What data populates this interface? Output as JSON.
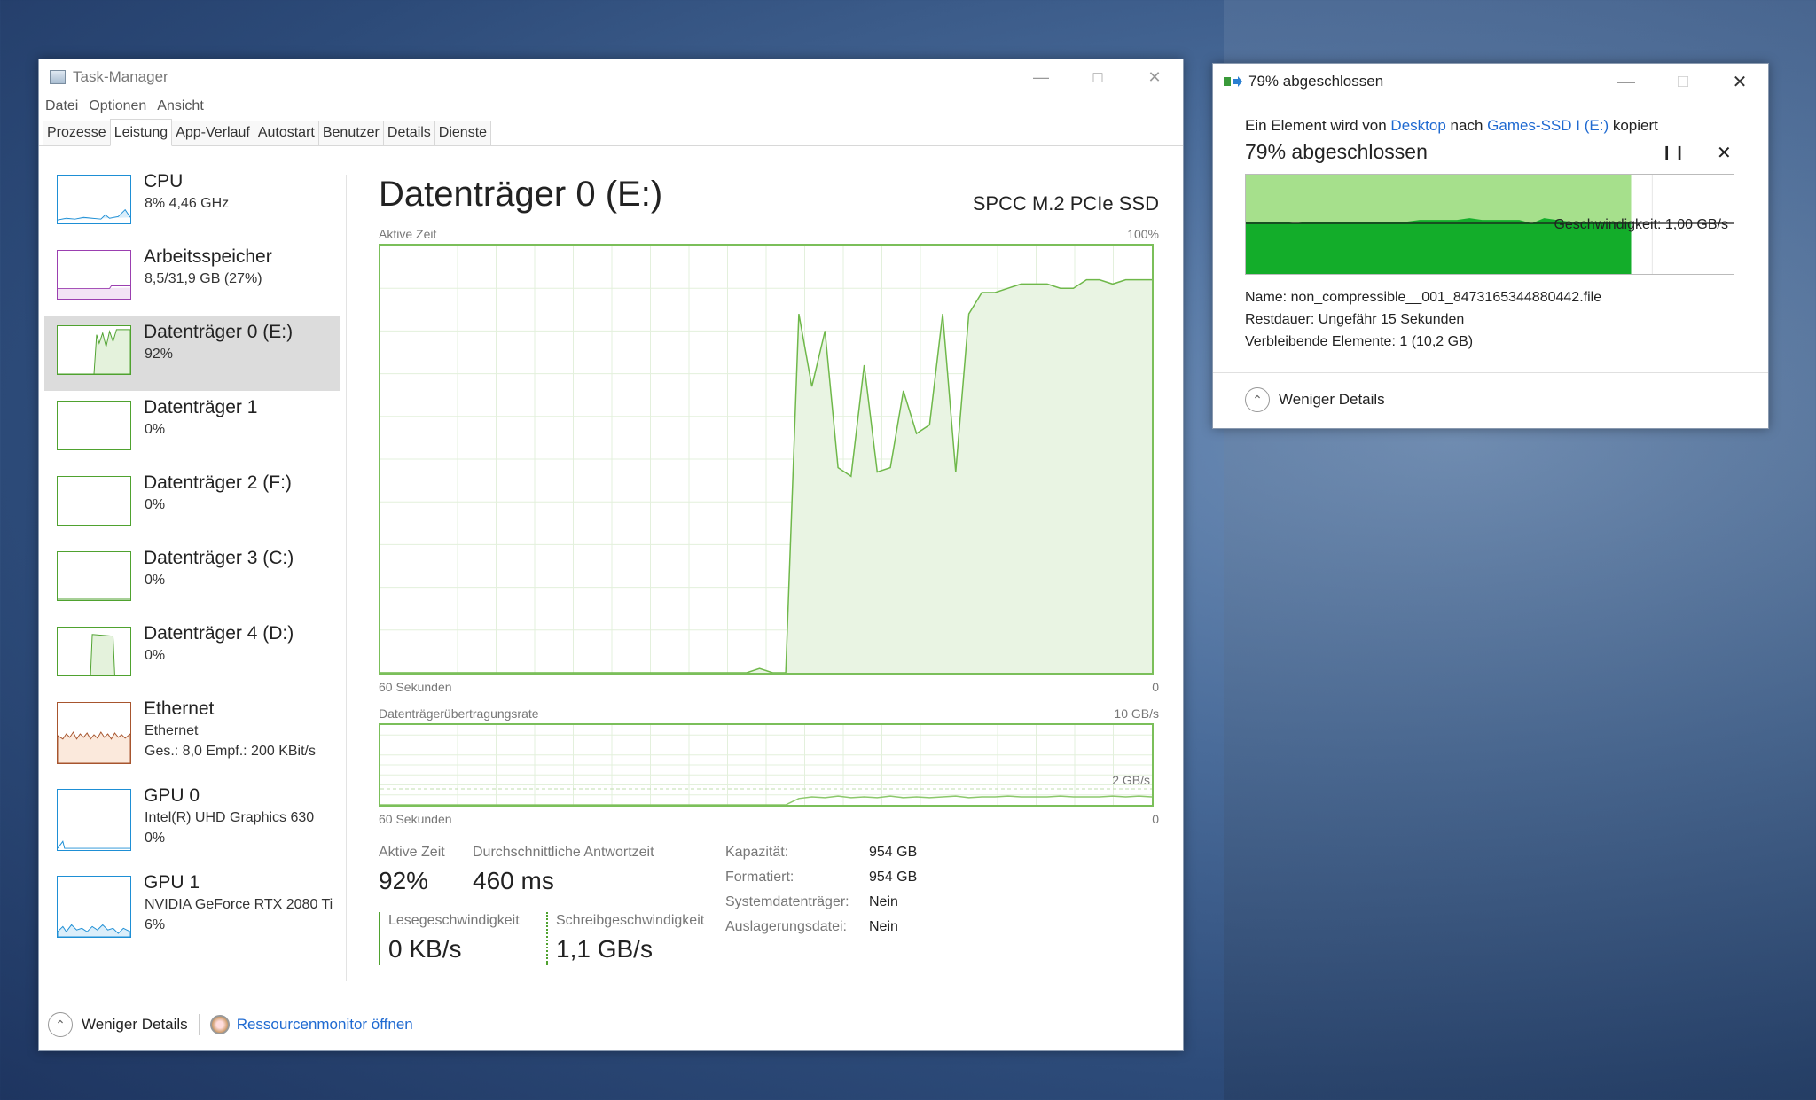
{
  "task_manager": {
    "title": "Task-Manager",
    "menu": [
      "Datei",
      "Optionen",
      "Ansicht"
    ],
    "tabs": [
      "Prozesse",
      "Leistung",
      "App-Verlauf",
      "Autostart",
      "Benutzer",
      "Details",
      "Dienste"
    ],
    "active_tab": "Leistung",
    "sidebar": [
      {
        "name": "CPU",
        "sub": "8%  4,46 GHz",
        "sub2": "",
        "color": "#1e8fd5",
        "selected": false
      },
      {
        "name": "Arbeitsspeicher",
        "sub": "8,5/31,9 GB (27%)",
        "sub2": "",
        "color": "#9b3fb0",
        "selected": false
      },
      {
        "name": "Datenträger 0 (E:)",
        "sub": "92%",
        "sub2": "",
        "color": "#4fa22f",
        "selected": true
      },
      {
        "name": "Datenträger 1",
        "sub": "0%",
        "sub2": "",
        "color": "#4fa22f",
        "selected": false
      },
      {
        "name": "Datenträger 2 (F:)",
        "sub": "0%",
        "sub2": "",
        "color": "#4fa22f",
        "selected": false
      },
      {
        "name": "Datenträger 3 (C:)",
        "sub": "0%",
        "sub2": "",
        "color": "#4fa22f",
        "selected": false
      },
      {
        "name": "Datenträger 4 (D:)",
        "sub": "0%",
        "sub2": "",
        "color": "#4fa22f",
        "selected": false
      },
      {
        "name": "Ethernet",
        "sub": "Ethernet",
        "sub2": "Ges.: 8,0  Empf.: 200 KBit/s",
        "color": "#a7552e",
        "selected": false
      },
      {
        "name": "GPU 0",
        "sub": "Intel(R) UHD Graphics 630",
        "sub2": "0%",
        "color": "#1e8fd5",
        "selected": false
      },
      {
        "name": "GPU 1",
        "sub": "NVIDIA GeForce RTX 2080 Ti",
        "sub2": "6%",
        "color": "#1e8fd5",
        "selected": false
      }
    ],
    "main": {
      "title": "Datenträger 0 (E:)",
      "model": "SPCC M.2 PCIe SSD",
      "graph1": {
        "label": "Aktive Zeit",
        "max_label": "100%",
        "bottom_left": "60 Sekunden",
        "bottom_right": "0"
      },
      "graph2": {
        "label": "Datenträgerübertragungsrate",
        "max_label": "10 GB/s",
        "mid_label": "2 GB/s",
        "bottom_left": "60 Sekunden",
        "bottom_right": "0"
      },
      "active_time_label": "Aktive Zeit",
      "active_time_value": "92%",
      "response_label": "Durchschnittliche Antwortzeit",
      "response_value": "460 ms",
      "read_label": "Lesegeschwindigkeit",
      "read_value": "0 KB/s",
      "write_label": "Schreibgeschwindigkeit",
      "write_value": "1,1 GB/s",
      "properties": [
        {
          "key": "Kapazität:",
          "value": "954 GB"
        },
        {
          "key": "Formatiert:",
          "value": "954 GB"
        },
        {
          "key": "Systemdatenträger:",
          "value": "Nein"
        },
        {
          "key": "Auslagerungsdatei:",
          "value": "Nein"
        }
      ]
    },
    "footer": {
      "less_details": "Weniger Details",
      "resource_monitor": "Ressourcenmonitor öffnen"
    }
  },
  "copy_dialog": {
    "title": "79% abgeschlossen",
    "line_prefix": "Ein Element wird von",
    "source": "Desktop",
    "line_mid": "nach",
    "destination": "Games-SSD I (E:)",
    "line_suffix": "kopiert",
    "percent_text": "79% abgeschlossen",
    "progress": 0.79,
    "speed": "Geschwindigkeit: 1,00 GB/s",
    "name_label": "Name:",
    "name_value": "non_compressible__001_8473165344880442.file",
    "remaining_label": "Restdauer:",
    "remaining_value": "Ungefähr 15 Sekunden",
    "items_label": "Verbleibende Elemente:",
    "items_value": "1 (10,2 GB)",
    "less_details": "Weniger Details"
  },
  "active_time_series": [
    0,
    0,
    0,
    0,
    0,
    0,
    0,
    0,
    0,
    0,
    0,
    0,
    0,
    0,
    0,
    0,
    0,
    0,
    0,
    0,
    0,
    0,
    0,
    0,
    0,
    0,
    0,
    0,
    0,
    1,
    0,
    0,
    84,
    67,
    80,
    48,
    46,
    72,
    47,
    48,
    66,
    56,
    58,
    84,
    47,
    84,
    89,
    89,
    90,
    91,
    91,
    91,
    90,
    90,
    92,
    92,
    91,
    92,
    92,
    92
  ],
  "transfer_series_gbs": [
    0,
    0,
    0,
    0,
    0,
    0,
    0,
    0,
    0,
    0,
    0,
    0,
    0,
    0,
    0,
    0,
    0,
    0,
    0,
    0,
    0,
    0,
    0,
    0,
    0,
    0,
    0,
    0,
    0,
    0,
    0,
    0,
    0.8,
    1.0,
    0.9,
    1.1,
    0.9,
    1.0,
    0.9,
    1.1,
    0.9,
    1.0,
    0.9,
    1.0,
    1.1,
    0.9,
    1.0,
    1.0,
    1.1,
    1.0,
    1.0,
    1.0,
    1.1,
    1.0,
    1.0,
    1.0,
    1.1,
    1.0,
    1.1,
    1.0
  ],
  "copy_speed_series": [
    60,
    60,
    60,
    60,
    58,
    60,
    60,
    60,
    60,
    60,
    60,
    60,
    60,
    60,
    62,
    62,
    62,
    62,
    64,
    62,
    62,
    62,
    62,
    58,
    64,
    62,
    60,
    60,
    60,
    60,
    60,
    60
  ]
}
